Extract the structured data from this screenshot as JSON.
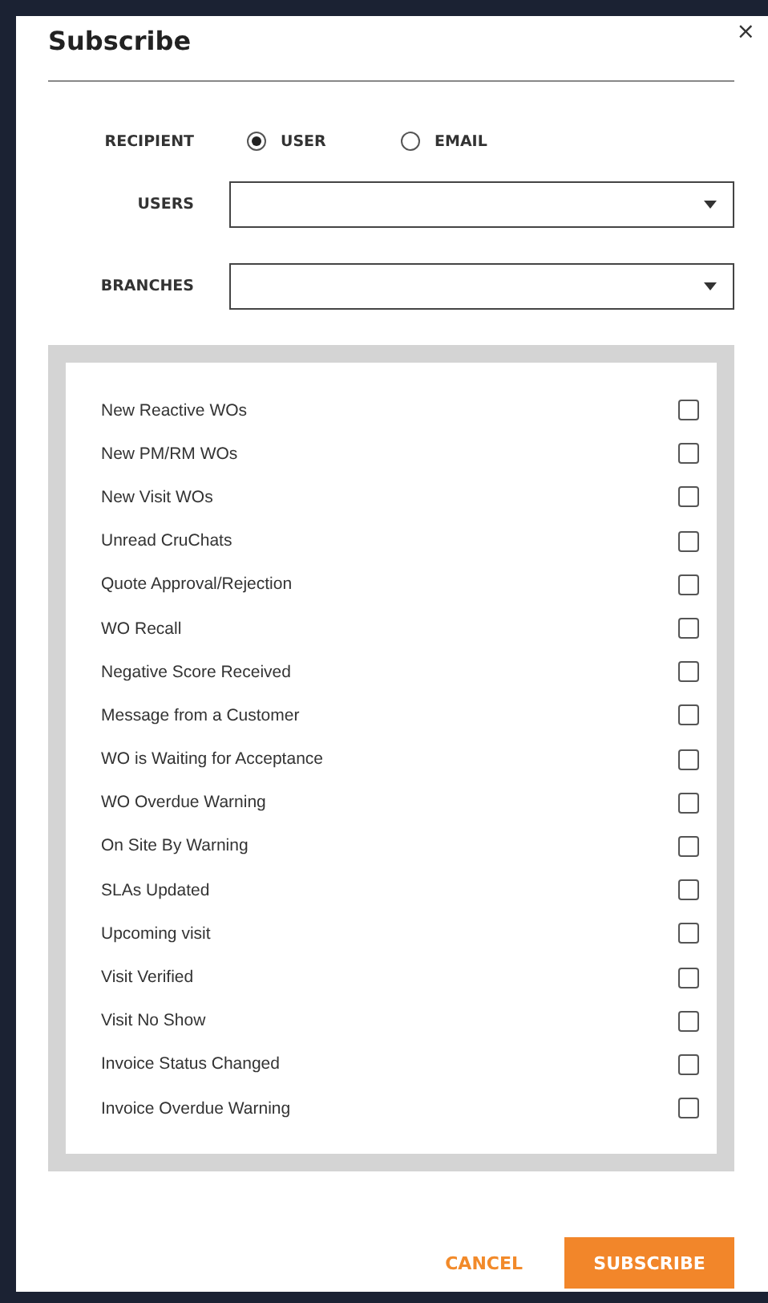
{
  "dialog": {
    "title": "Subscribe",
    "close": "×"
  },
  "recipient": {
    "label": "RECIPIENT",
    "options": [
      {
        "label": "USER",
        "selected": true
      },
      {
        "label": "EMAIL",
        "selected": false
      }
    ]
  },
  "fields": [
    {
      "label": "USERS"
    },
    {
      "label": "BRANCHES"
    }
  ],
  "notifications": [
    {
      "label": "New Reactive WOs",
      "checked": false
    },
    {
      "label": "New PM/RM WOs",
      "checked": false
    },
    {
      "label": "New Visit WOs",
      "checked": false
    },
    {
      "label": "Unread CruChats",
      "checked": false
    },
    {
      "label": "Quote Approval/Rejection",
      "checked": false
    },
    {
      "label": "WO Recall",
      "checked": false
    },
    {
      "label": "Negative Score Received",
      "checked": false
    },
    {
      "label": "Message from a Customer",
      "checked": false
    },
    {
      "label": "WO is Waiting for Acceptance",
      "checked": false
    },
    {
      "label": "WO Overdue Warning",
      "checked": false
    },
    {
      "label": "On Site By Warning",
      "checked": false
    },
    {
      "label": "SLAs Updated",
      "checked": false
    },
    {
      "label": "Upcoming visit",
      "checked": false
    },
    {
      "label": "Visit Verified",
      "checked": false
    },
    {
      "label": "Visit No Show",
      "checked": false
    },
    {
      "label": "Invoice Status Changed",
      "checked": false
    },
    {
      "label": "Invoice Overdue Warning",
      "checked": false
    }
  ],
  "buttons": [
    {
      "label": "CANCEL",
      "kind": "text"
    },
    {
      "label": "SUBSCRIBE",
      "kind": "primary"
    }
  ]
}
